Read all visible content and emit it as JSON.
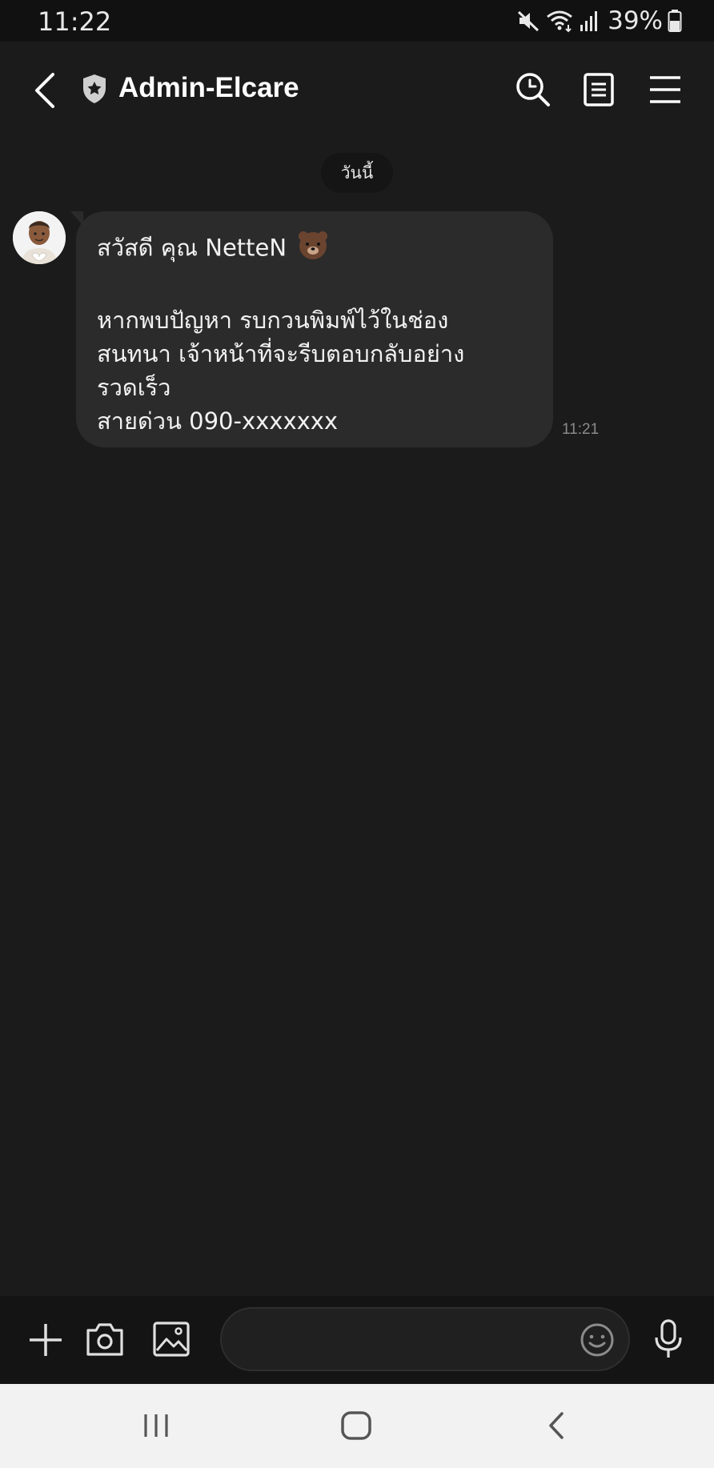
{
  "status_bar": {
    "time": "11:22",
    "battery": "39%"
  },
  "header": {
    "title": "Admin-Elcare"
  },
  "chat": {
    "date_label": "วันนี้",
    "message": {
      "greeting": "สวัสดี คุณ NetteN",
      "line2": "หากพบปัญหา รบกวนพิมพ์ไว้ในช่อง",
      "line3": "สนทนา เจ้าหน้าที่จะรีบตอบกลับอย่าง",
      "line4": "รวดเร็ว",
      "line5": "สายด่วน 090-xxxxxxx",
      "time": "11:21"
    }
  },
  "composer": {
    "placeholder": ""
  },
  "colors": {
    "background": "#1b1b1b",
    "bubble": "#2b2b2b",
    "navbar": "#f2f2f2"
  }
}
